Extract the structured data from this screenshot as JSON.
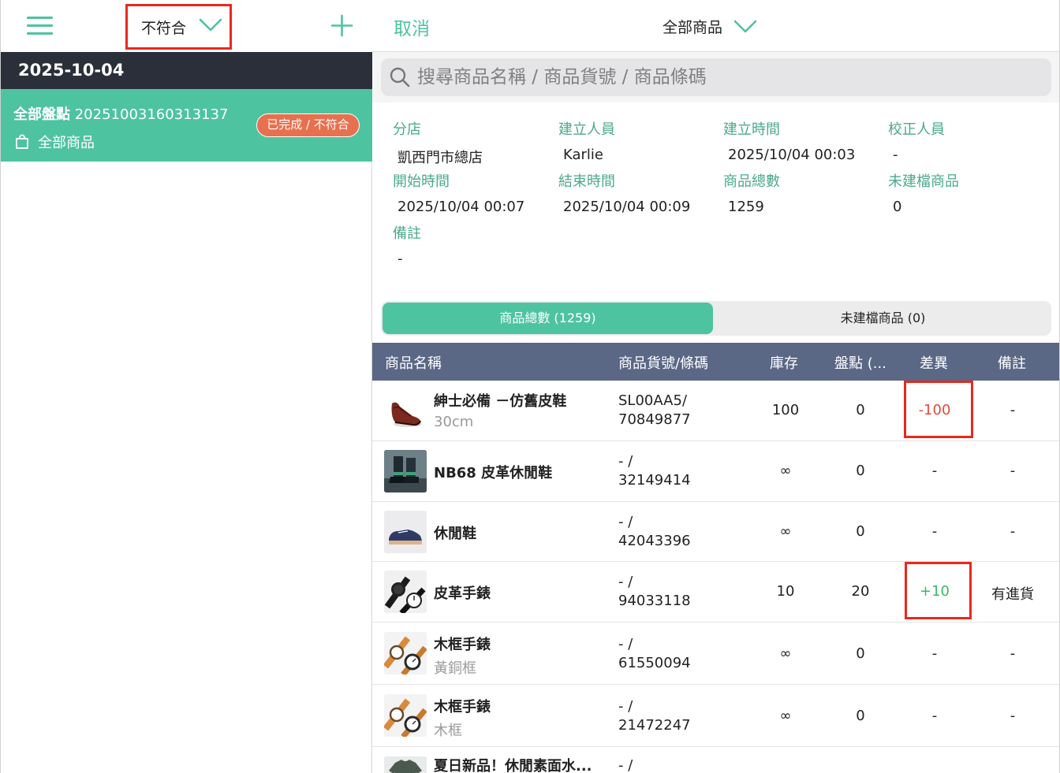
{
  "left": {
    "filter": {
      "label": "不符合"
    },
    "date": "2025-10-04",
    "record": {
      "type_label": "全部盤點",
      "record_id": "20251003160313137",
      "scope": "全部商品",
      "status_badge": "已完成 / 不符合"
    }
  },
  "right": {
    "cancel_label": "取消",
    "scope_select": "全部商品",
    "search": {
      "placeholder": "搜尋商品名稱 / 商品貨號 / 商品條碼"
    },
    "info": [
      {
        "label": "分店",
        "value": "凱西門市總店"
      },
      {
        "label": "建立人員",
        "value": "Karlie"
      },
      {
        "label": "建立時間",
        "value": "2025/10/04 00:03"
      },
      {
        "label": "校正人員",
        "value": "-"
      },
      {
        "label": "開始時間",
        "value": "2025/10/04 00:07"
      },
      {
        "label": "結束時間",
        "value": "2025/10/04 00:09"
      },
      {
        "label": "商品總數",
        "value": "1259"
      },
      {
        "label": "未建檔商品",
        "value": "0"
      },
      {
        "label": "備註",
        "value": "-"
      }
    ],
    "tabs": [
      {
        "label": "商品總數 (1259)",
        "active": true
      },
      {
        "label": "未建檔商品 (0)",
        "active": false
      }
    ],
    "table": {
      "columns": [
        "商品名稱",
        "商品貨號/條碼",
        "庫存",
        "盤點 (...",
        "差異",
        "備註"
      ],
      "rows": [
        {
          "name": "紳士必備 －仿舊皮鞋",
          "sub": "30cm",
          "code_line1": "SL00AA5/",
          "code_line2": "70849877",
          "stock": "100",
          "count": "0",
          "diff": "-100",
          "note": "-",
          "thumb": "brown-leather-shoe"
        },
        {
          "name": "NB68 皮革休閒鞋",
          "sub": "",
          "code_line1": "- /",
          "code_line2": "32149414",
          "stock": "∞",
          "count": "0",
          "diff": "-",
          "note": "-",
          "thumb": "boots-on-street"
        },
        {
          "name": "休閒鞋",
          "sub": "",
          "code_line1": "- /",
          "code_line2": "42043396",
          "stock": "∞",
          "count": "0",
          "diff": "-",
          "note": "-",
          "thumb": "blue-sneaker"
        },
        {
          "name": "皮革手錶",
          "sub": "",
          "code_line1": "- /",
          "code_line2": "94033118",
          "stock": "10",
          "count": "20",
          "diff": "+10",
          "note": "有進貨",
          "thumb": "black-watches"
        },
        {
          "name": "木框手錶",
          "sub": "黃銅框",
          "code_line1": "- /",
          "code_line2": "61550094",
          "stock": "∞",
          "count": "0",
          "diff": "-",
          "note": "-",
          "thumb": "wood-watches"
        },
        {
          "name": "木框手錶",
          "sub": "木框",
          "code_line1": "- /",
          "code_line2": "21472247",
          "stock": "∞",
          "count": "0",
          "diff": "-",
          "note": "-",
          "thumb": "wood-watches"
        },
        {
          "name": "夏日新品！休閒素面水...",
          "sub": "",
          "code_line1": "- /",
          "code_line2": "",
          "stock": "",
          "count": "",
          "diff": "",
          "note": "",
          "thumb": "green-shirt"
        }
      ]
    }
  },
  "colors": {
    "accent": "#4ec3a0",
    "dark_bar": "#2b2f3a",
    "table_header": "#5a6785",
    "badge": "#e7704f",
    "negative": "#e54a3a",
    "positive": "#3fb56b",
    "highlight": "#e8291c"
  }
}
